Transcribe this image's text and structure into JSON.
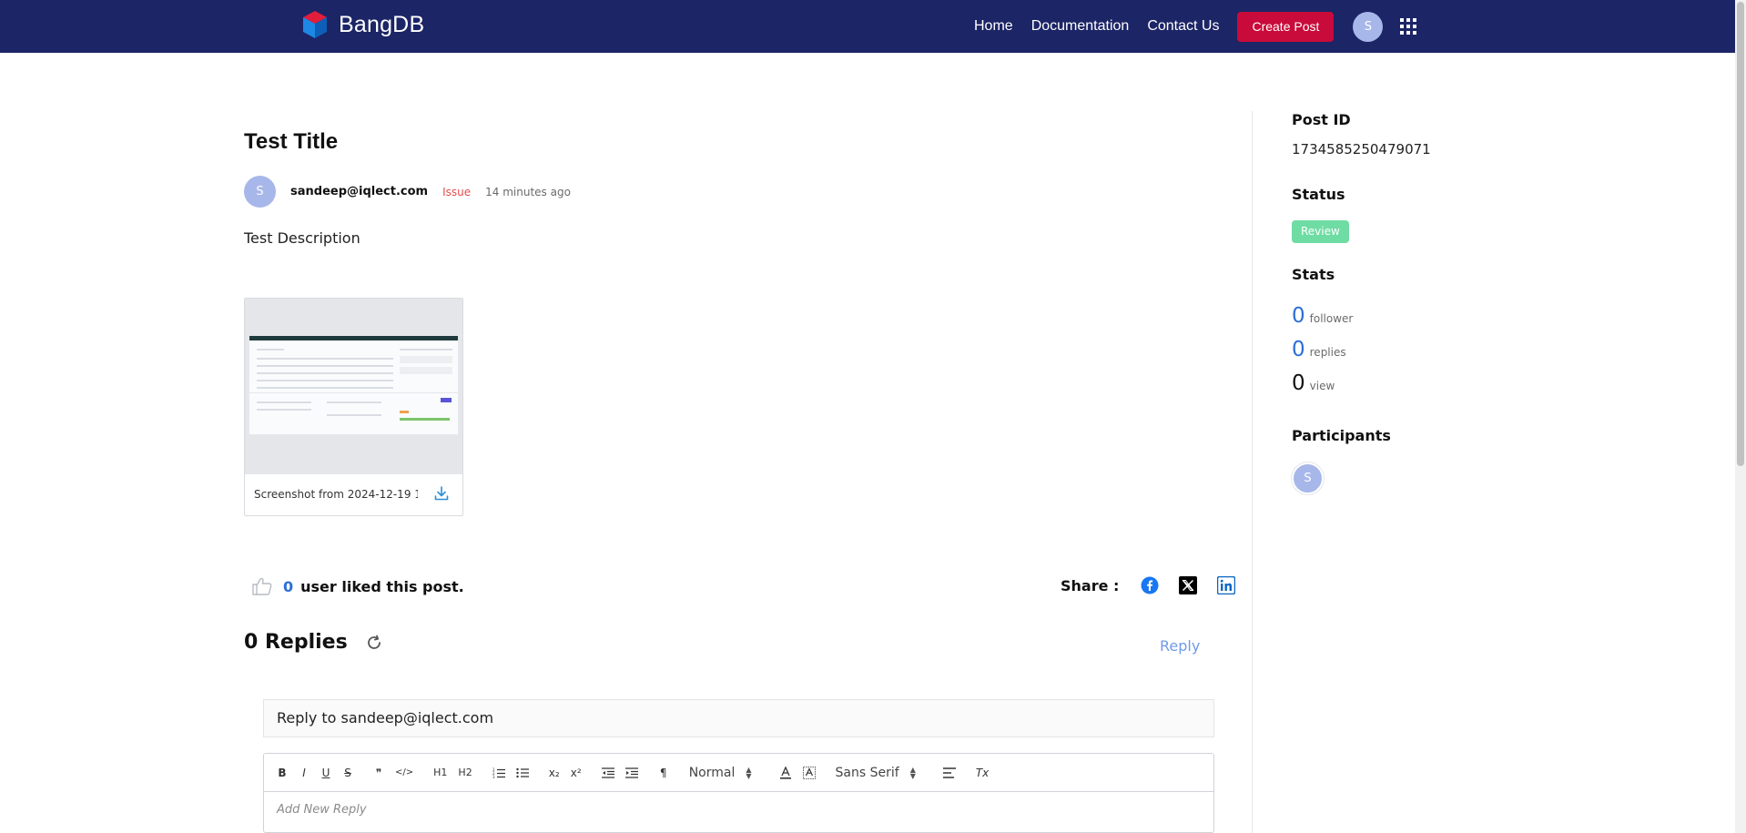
{
  "header": {
    "brand": "BangDB",
    "nav": [
      "Home",
      "Documentation",
      "Contact Us"
    ],
    "create_label": "Create Post",
    "avatar_letter": "S"
  },
  "post": {
    "title": "Test Title",
    "author_initial": "S",
    "author": "sandeep@iqlect.com",
    "tag": "Issue",
    "time": "14 minutes ago",
    "description": "Test Description",
    "attachment_name": "Screenshot from 2024-12-19 1...",
    "likes": "0",
    "likes_text": "user liked this post.",
    "share_label": "Share :"
  },
  "replies": {
    "title": "0 Replies",
    "reply_link": "Reply",
    "reply_to": "Reply to sandeep@iqlect.com"
  },
  "editor": {
    "toolbar": {
      "bold": "B",
      "italic": "I",
      "underline": "U",
      "strike": "S",
      "quote": "❞",
      "code": "</>",
      "h1": "H1",
      "h2": "H2",
      "subscript": "x₂",
      "superscript": "x²",
      "direction": "¶",
      "size_select": "Normal",
      "font_select": "Sans Serif",
      "clear": "Tx"
    },
    "placeholder": "Add New Reply"
  },
  "sidebar": {
    "post_id_label": "Post ID",
    "post_id": "1734585250479071",
    "status_label": "Status",
    "status": "Review",
    "stats_label": "Stats",
    "followers": "0",
    "followers_label": "follower",
    "replies": "0",
    "replies_label": "replies",
    "views": "0",
    "views_label": "view",
    "participants_label": "Participants",
    "participant_initial": "S"
  },
  "colors": {
    "navbar": "#1c2566",
    "create_button": "#c80b3a",
    "accent_blue": "#2b6fd6",
    "status_review": "#6fdca3",
    "tag_issue": "#e24c4c"
  }
}
